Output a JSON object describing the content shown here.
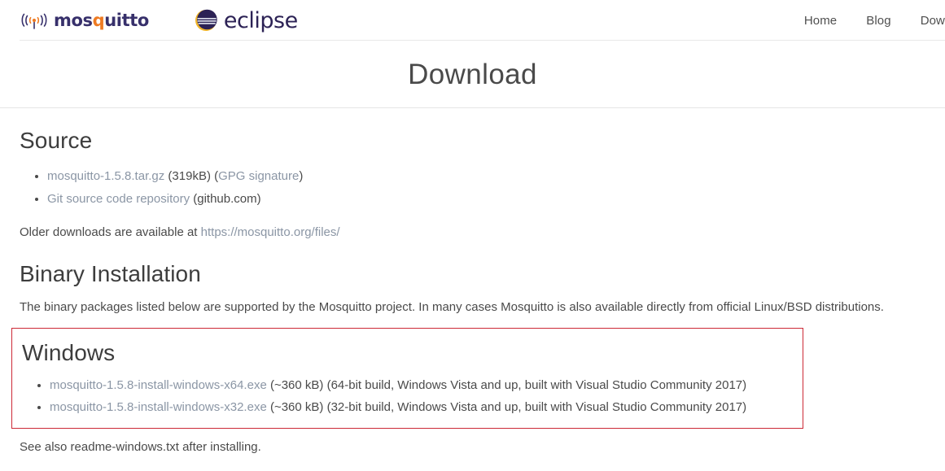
{
  "header": {
    "brand_mosquitto": {
      "name": "mosquitto",
      "word_before_q": "mos",
      "q_letter": "q",
      "word_after_q": "uitto",
      "icon": "signal-waves-icon"
    },
    "brand_eclipse": {
      "name": "eclipse",
      "icon": "eclipse-logo-icon"
    },
    "nav": [
      {
        "label": "Home"
      },
      {
        "label": "Blog"
      },
      {
        "label": "Dow"
      }
    ]
  },
  "page": {
    "title": "Download"
  },
  "sections": {
    "source": {
      "heading": "Source",
      "items": [
        {
          "link": "mosquitto-1.5.8.tar.gz",
          "text_after": " (319kB) (",
          "link2": "GPG signature",
          "text_end": ")"
        },
        {
          "link": "Git source code repository",
          "text_after": " (github.com)",
          "link2": "",
          "text_end": ""
        }
      ],
      "older_prefix": "Older downloads are available at ",
      "older_link": "https://mosquitto.org/files/"
    },
    "binary": {
      "heading": "Binary Installation",
      "paragraph": "The binary packages listed below are supported by the Mosquitto project. In many cases Mosquitto is also available directly from official Linux/BSD distributions."
    },
    "windows": {
      "heading": "Windows",
      "highlight_color": "#cc2936",
      "items": [
        {
          "link": "mosquitto-1.5.8-install-windows-x64.exe",
          "text_after": " (~360 kB) (64-bit build, Windows Vista and up, built with Visual Studio Community 2017)"
        },
        {
          "link": "mosquitto-1.5.8-install-windows-x32.exe",
          "text_after": " (~360 kB) (32-bit build, Windows Vista and up, built with Visual Studio Community 2017)"
        }
      ],
      "note": "See also readme-windows.txt after installing."
    }
  },
  "colors": {
    "link": "#8b96a5",
    "text": "#4a4a4a",
    "brand_purple": "#37306b",
    "brand_orange": "#ee7b23",
    "eclipse_navy": "#2c2255",
    "highlight_red": "#cc2936"
  }
}
